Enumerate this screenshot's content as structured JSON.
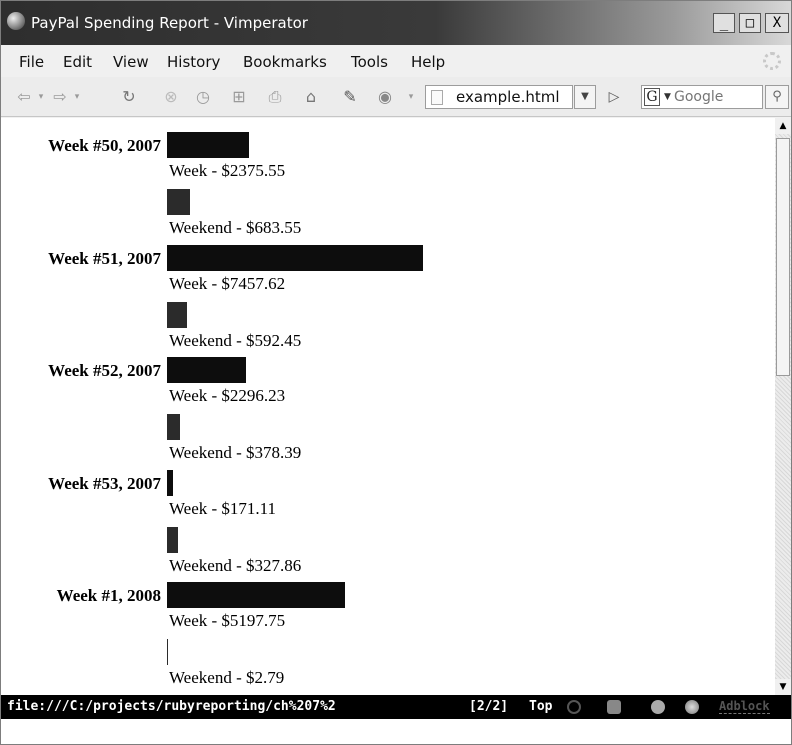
{
  "window": {
    "title": "PayPal Spending Report - Vimperator",
    "minimize_label": "_",
    "maximize_label": "□",
    "close_label": "X"
  },
  "menu": [
    {
      "label": "File"
    },
    {
      "label": "Edit"
    },
    {
      "label": "View"
    },
    {
      "label": "History"
    },
    {
      "label": "Bookmarks"
    },
    {
      "label": "Tools"
    },
    {
      "label": "Help"
    }
  ],
  "nav": {
    "url": "example.html",
    "search_engine_letter": "G",
    "search_placeholder": "Google"
  },
  "report": {
    "max_value": 7457.62,
    "rows": [
      {
        "label": "Week #50, 2007",
        "week_caption": "Week - $2375.55",
        "week_value": 2375.55,
        "weekend_caption": "Weekend - $683.55",
        "weekend_value": 683.55
      },
      {
        "label": "Week #51, 2007",
        "week_caption": "Week - $7457.62",
        "week_value": 7457.62,
        "weekend_caption": "Weekend - $592.45",
        "weekend_value": 592.45
      },
      {
        "label": "Week #52, 2007",
        "week_caption": "Week - $2296.23",
        "week_value": 2296.23,
        "weekend_caption": "Weekend - $378.39",
        "weekend_value": 378.39
      },
      {
        "label": "Week #53, 2007",
        "week_caption": "Week - $171.11",
        "week_value": 171.11,
        "weekend_caption": "Weekend - $327.86",
        "weekend_value": 327.86
      },
      {
        "label": "Week #1, 2008",
        "week_caption": "Week - $5197.75",
        "week_value": 5197.75,
        "weekend_caption": "Weekend - $2.79",
        "weekend_value": 2.79
      }
    ]
  },
  "colors": {
    "week_bar": "#0d0d0d",
    "weekend_bar": "#2b2b2b"
  },
  "status": {
    "url": "file:///C:/projects/rubyreporting/ch%207%2",
    "position": "[2/2]",
    "scroll": "Top",
    "adblock_label": "Adblock"
  }
}
